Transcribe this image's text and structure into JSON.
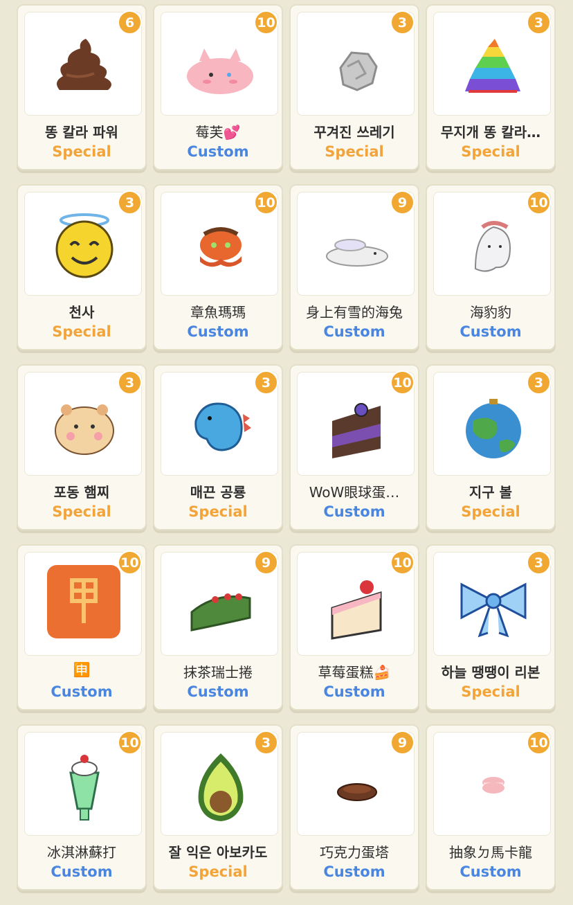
{
  "colors": {
    "special": "#f2a43a",
    "custom": "#4a86e0",
    "badge": "#f1a832",
    "background": "#ece8d6"
  },
  "items": [
    {
      "name": "똥 칼라 파워",
      "type": "Special",
      "count": "6",
      "icon": "poop-brown-icon"
    },
    {
      "name": "莓芙💕",
      "type": "Custom",
      "count": "10",
      "icon": "pink-cat-cloud-icon"
    },
    {
      "name": "꾸겨진 쓰레기",
      "type": "Special",
      "count": "3",
      "icon": "crumpled-paper-icon"
    },
    {
      "name": "무지개 똥 칼라…",
      "type": "Special",
      "count": "3",
      "icon": "rainbow-poop-icon"
    },
    {
      "name": "천사",
      "type": "Special",
      "count": "3",
      "icon": "angel-smiley-icon"
    },
    {
      "name": "章魚瑪瑪",
      "type": "Custom",
      "count": "10",
      "icon": "octopus-icon"
    },
    {
      "name": "身上有雪的海兔",
      "type": "Custom",
      "count": "9",
      "icon": "snowy-sea-bunny-icon"
    },
    {
      "name": "海豹豹",
      "type": "Custom",
      "count": "10",
      "icon": "seal-ghost-icon"
    },
    {
      "name": "포동 햄찌",
      "type": "Special",
      "count": "3",
      "icon": "hamster-icon"
    },
    {
      "name": "매끈 공룡",
      "type": "Special",
      "count": "3",
      "icon": "blue-dinosaur-icon"
    },
    {
      "name": "WoW眼球蛋…",
      "type": "Custom",
      "count": "10",
      "icon": "chocolate-cake-slice-icon"
    },
    {
      "name": "지구 볼",
      "type": "Special",
      "count": "3",
      "icon": "earth-ornament-icon"
    },
    {
      "name": "🈸",
      "type": "Custom",
      "count": "10",
      "icon": "orange-kanji-tile-icon"
    },
    {
      "name": "抹茶瑞士捲",
      "type": "Custom",
      "count": "9",
      "icon": "matcha-roll-icon"
    },
    {
      "name": "草莓蛋糕🍰",
      "type": "Custom",
      "count": "10",
      "icon": "strawberry-cake-icon"
    },
    {
      "name": "하늘 땡땡이 리본",
      "type": "Special",
      "count": "3",
      "icon": "blue-ribbon-icon"
    },
    {
      "name": "冰淇淋蘇打",
      "type": "Custom",
      "count": "10",
      "icon": "ice-cream-soda-icon"
    },
    {
      "name": "잘 익은 아보카도",
      "type": "Special",
      "count": "3",
      "icon": "avocado-icon"
    },
    {
      "name": "巧克力蛋塔",
      "type": "Custom",
      "count": "9",
      "icon": "chocolate-tart-icon"
    },
    {
      "name": "抽象ㄉ馬卡龍",
      "type": "Custom",
      "count": "10",
      "icon": "macaron-icon"
    }
  ]
}
